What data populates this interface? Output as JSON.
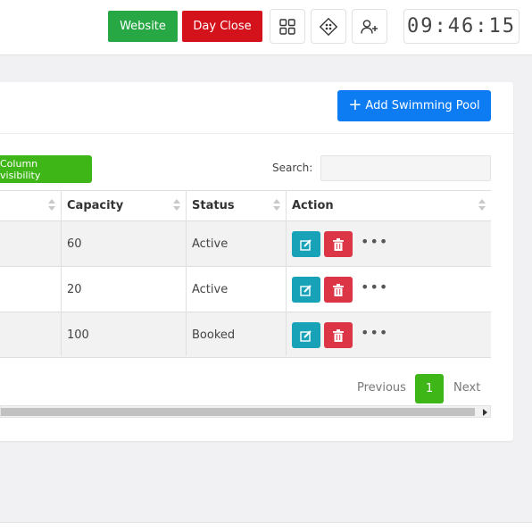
{
  "header": {
    "website_label": "Website",
    "day_close_label": "Day Close",
    "icons": [
      "grid-icon",
      "diamond-apps-icon",
      "add-user-icon"
    ],
    "clock": "09:46:15"
  },
  "colors": {
    "website_button": "#28a745",
    "day_close_button": "#d3121b",
    "add_button": "#0d7cf2",
    "column_visibility_button": "#3fb618",
    "edit_action": "#17a2b8",
    "delete_action": "#dc3545",
    "active_page": "#3fb618"
  },
  "card": {
    "add_button_label": "Add Swimming Pool",
    "column_visibility_label": "Column visibility",
    "search_label": "Search:",
    "search_value": ""
  },
  "table": {
    "columns": [
      "Capacity",
      "Status",
      "Action"
    ],
    "rows": [
      {
        "capacity": "60",
        "status": "Active"
      },
      {
        "capacity": "20",
        "status": "Active"
      },
      {
        "capacity": "100",
        "status": "Booked"
      }
    ],
    "action_icons": [
      "edit-icon",
      "trash-icon",
      "more-icon"
    ],
    "more_label": "•••"
  },
  "pagination": {
    "previous_label": "Previous",
    "current_page": "1",
    "next_label": "Next"
  }
}
